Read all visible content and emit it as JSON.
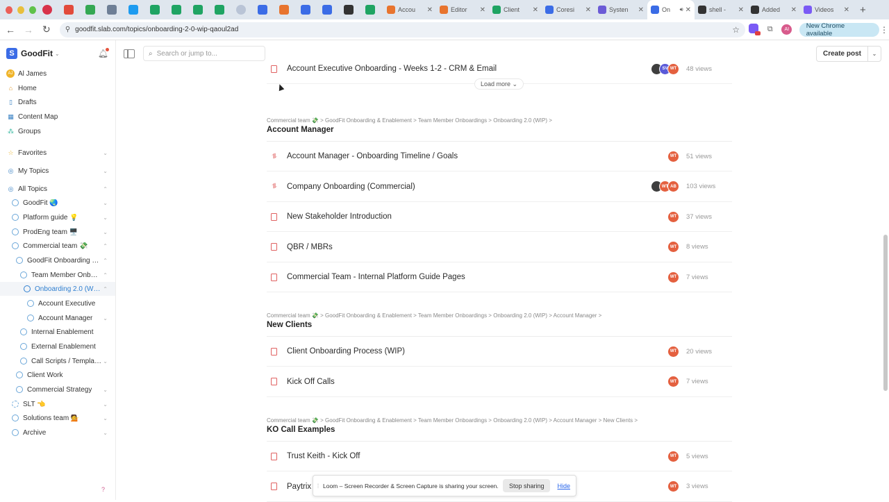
{
  "browser": {
    "tabs": [
      {
        "title": "Accou",
        "color": "#e8742e"
      },
      {
        "title": "Editor",
        "color": "#e8742e"
      },
      {
        "title": "Client",
        "color": "#1fa463"
      },
      {
        "title": "Coresi",
        "color": "#3b6ce6"
      },
      {
        "title": "Systen",
        "color": "#6b5bd6"
      },
      {
        "title": "On",
        "color": "#3b6ce6",
        "active": true
      },
      {
        "title": "shell -",
        "color": "#333333"
      },
      {
        "title": "Added",
        "color": "#333333"
      },
      {
        "title": "Videos",
        "color": "#7a5af5"
      }
    ],
    "url": "goodfit.slab.com/topics/onboarding-2-0-wip-qaoul2ad",
    "update_label": "New Chrome available",
    "profile_initials": "AI"
  },
  "header": {
    "workspace": "GoodFit",
    "search_placeholder": "Search or jump to...",
    "create_post": "Create post"
  },
  "sidebar": {
    "user": "Al James",
    "user_initials": "AJ",
    "nav": {
      "home": "Home",
      "drafts": "Drafts",
      "content_map": "Content Map",
      "groups": "Groups",
      "favorites": "Favorites",
      "my_topics": "My Topics",
      "all_topics": "All Topics"
    },
    "topics": [
      {
        "label": "GoodFit 🌏"
      },
      {
        "label": "Platform guide 💡"
      },
      {
        "label": "ProdEng team 🖥️"
      },
      {
        "label": "Commercial team 💸"
      },
      {
        "label": "GoodFit Onboarding & ..."
      },
      {
        "label": "Team Member Onboa..."
      },
      {
        "label": "Onboarding 2.0 (WIP)"
      },
      {
        "label": "Account Executive"
      },
      {
        "label": "Account Manager"
      },
      {
        "label": "Internal Enablement"
      },
      {
        "label": "External Enablement"
      },
      {
        "label": "Call Scripts / Templat..."
      },
      {
        "label": "Client Work"
      },
      {
        "label": "Commercial Strategy"
      },
      {
        "label": "SLT 👈"
      },
      {
        "label": "Solutions team 💁"
      },
      {
        "label": "Archive"
      }
    ],
    "help": "?"
  },
  "main": {
    "top_row": {
      "title": "Account Executive Onboarding - Weeks 1-2 - CRM & Email",
      "views": "48 views",
      "avatars": [
        "",
        "SV",
        "WT"
      ]
    },
    "load_more": "Load more",
    "sections": [
      {
        "breadcrumb": "Commercial team 💸  >  GoodFit Onboarding & Enablement  >  Team Member Onboardings  >  Onboarding 2.0 (WIP)  >",
        "title": "Account Manager",
        "posts": [
          {
            "title": "Account Manager - Onboarding Timeline / Goals",
            "views": "51 views",
            "avatars": [
              "WT"
            ],
            "icon": "related"
          },
          {
            "title": "Company Onboarding (Commercial)",
            "views": "103 views",
            "avatars": [
              "",
              "WT",
              "AB"
            ],
            "icon": "related"
          },
          {
            "title": "New Stakeholder Introduction",
            "views": "37 views",
            "avatars": [
              "WT"
            ],
            "icon": "doc"
          },
          {
            "title": "QBR / MBRs",
            "views": "8 views",
            "avatars": [
              "WT"
            ],
            "icon": "doc"
          },
          {
            "title": "Commercial Team - Internal Platform Guide Pages",
            "views": "7 views",
            "avatars": [
              "WT"
            ],
            "icon": "doc"
          }
        ]
      },
      {
        "breadcrumb": "Commercial team 💸  >  GoodFit Onboarding & Enablement  >  Team Member Onboardings  >  Onboarding 2.0 (WIP)  >  Account Manager  >",
        "title": "New Clients",
        "posts": [
          {
            "title": "Client Onboarding Process (WIP)",
            "views": "20 views",
            "avatars": [
              "WT"
            ],
            "icon": "doc"
          },
          {
            "title": "Kick Off Calls",
            "views": "7 views",
            "avatars": [
              "WT"
            ],
            "icon": "doc"
          }
        ]
      },
      {
        "breadcrumb": "Commercial team 💸  >  GoodFit Onboarding & Enablement  >  Team Member Onboardings  >  Onboarding 2.0 (WIP)  >  Account Manager  >  New Clients  >",
        "title": "KO Call Examples",
        "posts": [
          {
            "title": "Trust Keith - Kick Off",
            "views": "5 views",
            "avatars": [
              "WT"
            ],
            "icon": "doc"
          },
          {
            "title": "Paytrix",
            "views": "3 views",
            "avatars": [
              "WT"
            ],
            "icon": "doc"
          }
        ]
      }
    ]
  },
  "loom": {
    "message": "Loom – Screen Recorder & Screen Capture is sharing your screen.",
    "stop": "Stop sharing",
    "hide": "Hide"
  },
  "colors": {
    "accent": "#2f7fd0",
    "avatar_wt": "#e4603f",
    "avatar_sv": "#5a5ad8"
  }
}
